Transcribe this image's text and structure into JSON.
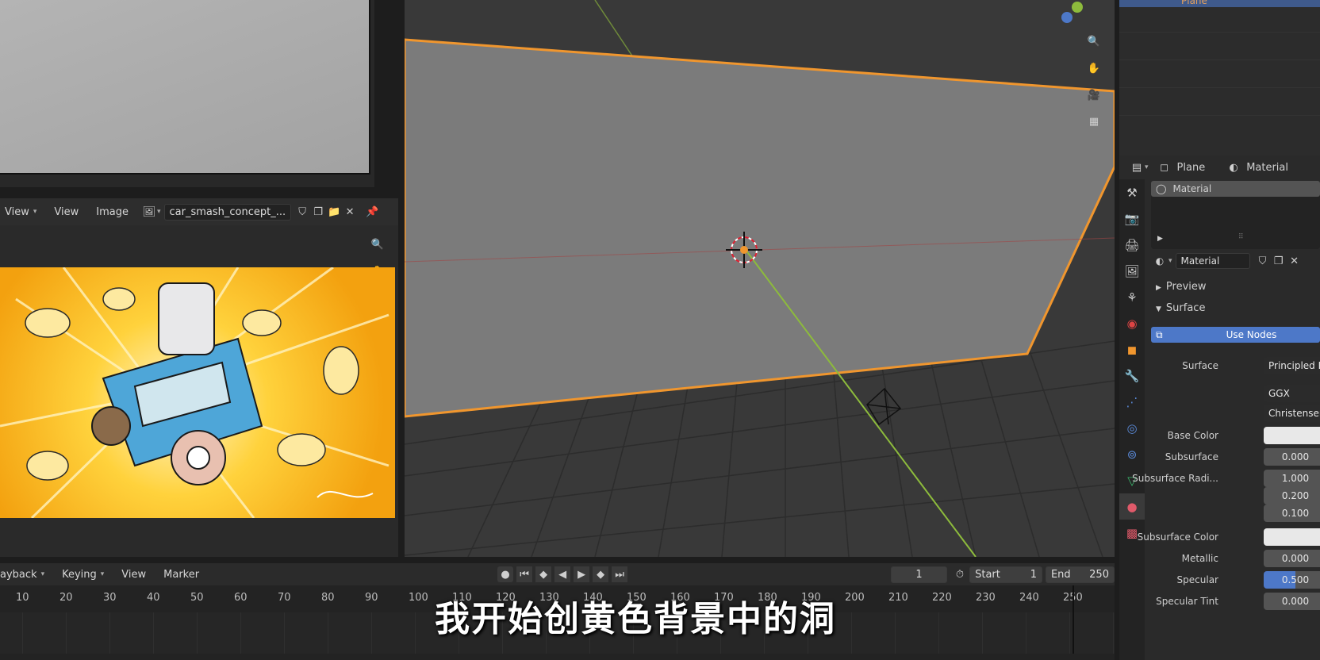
{
  "image_editor": {
    "menu": {
      "view1": "View",
      "view2": "View",
      "image": "Image"
    },
    "image_name": "car_smash_concept_..."
  },
  "timeline": {
    "menu": {
      "playback": "ayback",
      "keying": "Keying",
      "view": "View",
      "marker": "Marker"
    },
    "current_frame": "1",
    "start_label": "Start",
    "start_value": "1",
    "end_label": "End",
    "end_value": "250",
    "ruler": [
      "10",
      "20",
      "30",
      "40",
      "50",
      "60",
      "70",
      "80",
      "90",
      "100",
      "110",
      "120",
      "130",
      "140",
      "150",
      "160",
      "170",
      "180",
      "190",
      "200",
      "210",
      "220",
      "230",
      "240",
      "250"
    ]
  },
  "outliner": {
    "selected_object": "Plane"
  },
  "properties": {
    "breadcrumb": {
      "object": "Plane",
      "material": "Material"
    },
    "material_slot": "Material",
    "material_name": "Material",
    "sections": {
      "preview": "Preview",
      "surface": "Surface"
    },
    "use_nodes": "Use Nodes",
    "surface_label": "Surface",
    "surface_value": "Principled B",
    "distribution": "GGX",
    "subsurface_method": "Christensen",
    "rows": [
      {
        "label": "Base Color",
        "value": ""
      },
      {
        "label": "Subsurface",
        "value": "0.000"
      },
      {
        "label": "Subsurface Radi...",
        "value": "1.000"
      },
      {
        "label": "",
        "value": "0.200"
      },
      {
        "label": "",
        "value": "0.100"
      },
      {
        "label": "Subsurface Color",
        "value": ""
      },
      {
        "label": "Metallic",
        "value": "0.000"
      },
      {
        "label": "Specular",
        "value": "0.500",
        "fill": 0.5
      },
      {
        "label": "Specular Tint",
        "value": "0.000"
      }
    ]
  },
  "subtitle": "我开始创黄色背景中的洞",
  "colors": {
    "selection": "#f0962e",
    "accent": "#4d78c8",
    "yaxis": "#8dbb3c",
    "xaxis": "#b84a4a"
  }
}
